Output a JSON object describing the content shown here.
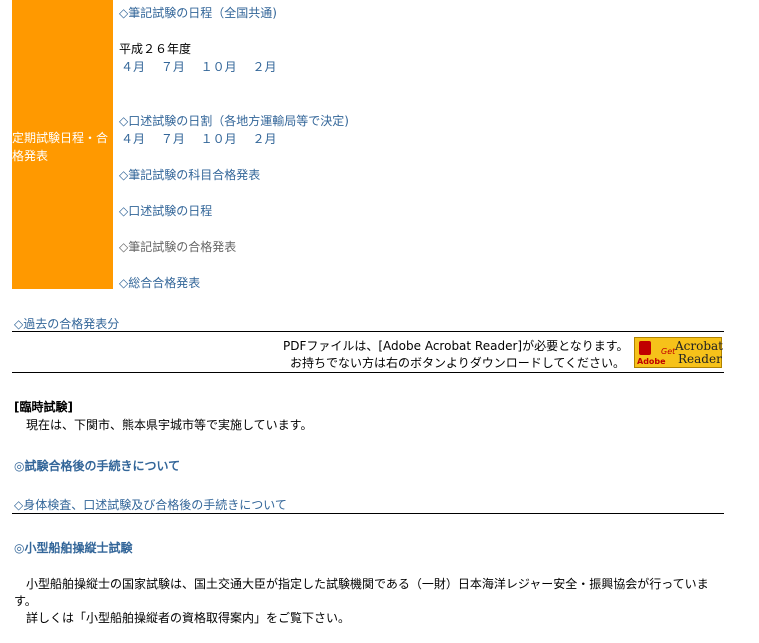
{
  "schedule": {
    "label": "定期試験日程・合格発表",
    "written_exam_schedule": "◇筆記試験の日程（全国共通)",
    "fiscal_year": "平成２６年度",
    "written_months": "４月　 ７月　 １０月　 ２月",
    "oral_exam_schedule": "◇口述試験の日割（各地方運輸局等で決定)",
    "oral_months": "４月　 ７月　 １０月　 ２月",
    "subject_pass_announcement": "◇筆記試験の科目合格発表",
    "oral_exam_dates": "◇口述試験の日程",
    "written_pass_announcement": "◇筆記試験の合格発表",
    "overall_pass_announcement": "◇総合合格発表"
  },
  "past_results_link": "◇過去の合格発表分",
  "pdf_notice": {
    "line1": "PDFファイルは、[Adobe Acrobat Reader]が必要となります。",
    "line2": "お持ちでない方は右のボタンよりダウンロードしてください。",
    "badge": {
      "adobe": "Adobe",
      "get": "Get",
      "name1": "Acrobat",
      "name2": "Reader",
      "mark": "®"
    }
  },
  "special_exam": {
    "heading": "[臨時試験]",
    "text": "現在は、下関市、熊本県宇城市等で実施しています。"
  },
  "after_pass_procedures": "◎試験合格後の手続きについて",
  "physical_exam_link": "◇身体検査、口述試験及び合格後の手続きについて",
  "small_boat": {
    "heading": "◎小型船舶操縦士試験",
    "text_line1": "小型船舶操縦士の国家試験は、国土交通大臣が指定した試験機関である（一財）日本海洋レジャー安全・振興協会が行っていま",
    "text_line2": "す。",
    "text_line3": "詳しくは「小型船舶操縦者の資格取得案内」をご覧下さい。"
  },
  "colors": {
    "label_bg": "#ff9900",
    "link": "#336699",
    "badge_bg": "#f6c21a"
  }
}
